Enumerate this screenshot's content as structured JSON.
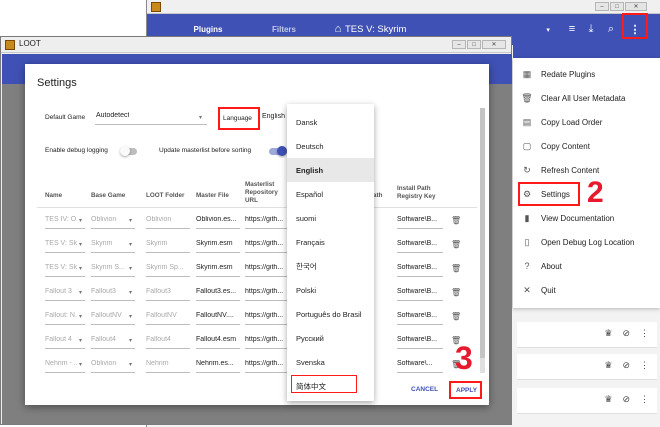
{
  "back_window": {
    "tabs": [
      "Plugins",
      "Filters"
    ],
    "game_title": "TES V: Skyrim",
    "menu_items": [
      {
        "label": "Redate Plugins",
        "icon": "calendar-icon"
      },
      {
        "label": "Clear All User Metadata",
        "icon": "trash-icon"
      },
      {
        "label": "Copy Load Order",
        "icon": "list-icon"
      },
      {
        "label": "Copy Content",
        "icon": "clipboard-icon"
      },
      {
        "label": "Refresh Content",
        "icon": "refresh-icon"
      },
      {
        "label": "Settings",
        "icon": "gear-icon"
      },
      {
        "label": "View Documentation",
        "icon": "book-icon"
      },
      {
        "label": "Open Debug Log Location",
        "icon": "file-icon"
      },
      {
        "label": "About",
        "icon": "help-icon"
      },
      {
        "label": "Quit",
        "icon": "close-icon"
      }
    ]
  },
  "middle_window": {
    "title": "LOOT"
  },
  "dialog": {
    "title": "Settings",
    "default_game_label": "Default Game",
    "default_game_value": "Autodetect",
    "language_label": "Language",
    "language_value": "English",
    "debug_logging_label": "Enable debug logging",
    "update_masterlist_label": "Update masterlist before sorting",
    "columns": [
      "Name",
      "Base Game",
      "LOOT Folder",
      "Master File",
      "Masterlist Repository URL",
      "ath",
      "Install Path Registry Key"
    ],
    "rows": [
      {
        "name": "TES IV: O...",
        "base": "Oblivion",
        "folder": "Oblivion",
        "master": "Oblivion.es...",
        "url": "https://gith...",
        "reg": "Software\\B..."
      },
      {
        "name": "TES V: Sk...",
        "base": "Skyrim",
        "folder": "Skyrim",
        "master": "Skyrim.esm",
        "url": "https://gith...",
        "reg": "Software\\B..."
      },
      {
        "name": "TES V: Sk...",
        "base": "Skyrim S...",
        "folder": "Skyrim Sp...",
        "master": "Skyrim.esm",
        "url": "https://gith...",
        "reg": "Software\\B..."
      },
      {
        "name": "Fallout 3",
        "base": "Fallout3",
        "folder": "Fallout3",
        "master": "Fallout3.es...",
        "url": "https://gith...",
        "reg": "Software\\B..."
      },
      {
        "name": "Fallout: N...",
        "base": "FalloutNV",
        "folder": "FalloutNV",
        "master": "FalloutNV....",
        "url": "https://gith...",
        "reg": "Software\\B..."
      },
      {
        "name": "Fallout 4",
        "base": "Fallout4",
        "folder": "Fallout4",
        "master": "Fallout4.esm",
        "url": "https://gith...",
        "reg": "Software\\B..."
      },
      {
        "name": "Nehrim - ...",
        "base": "Oblivion",
        "folder": "Nehrim",
        "master": "Nehrim.es...",
        "url": "https://gith...",
        "reg": "Software\\..."
      }
    ],
    "cancel_label": "CANCEL",
    "apply_label": "APPLY"
  },
  "languages": [
    "Dansk",
    "Deutsch",
    "English",
    "Español",
    "suomi",
    "Français",
    "한국어",
    "Polski",
    "Português do Brasil",
    "Русский",
    "Svenska",
    "简体中文"
  ],
  "selected_language": "English",
  "annotations": [
    "2",
    "3"
  ],
  "colors": {
    "toolbar": "#3f51b5",
    "accent": "#ff4081",
    "toggle_on": "#3f51b5",
    "annotation": "#e8192c"
  }
}
